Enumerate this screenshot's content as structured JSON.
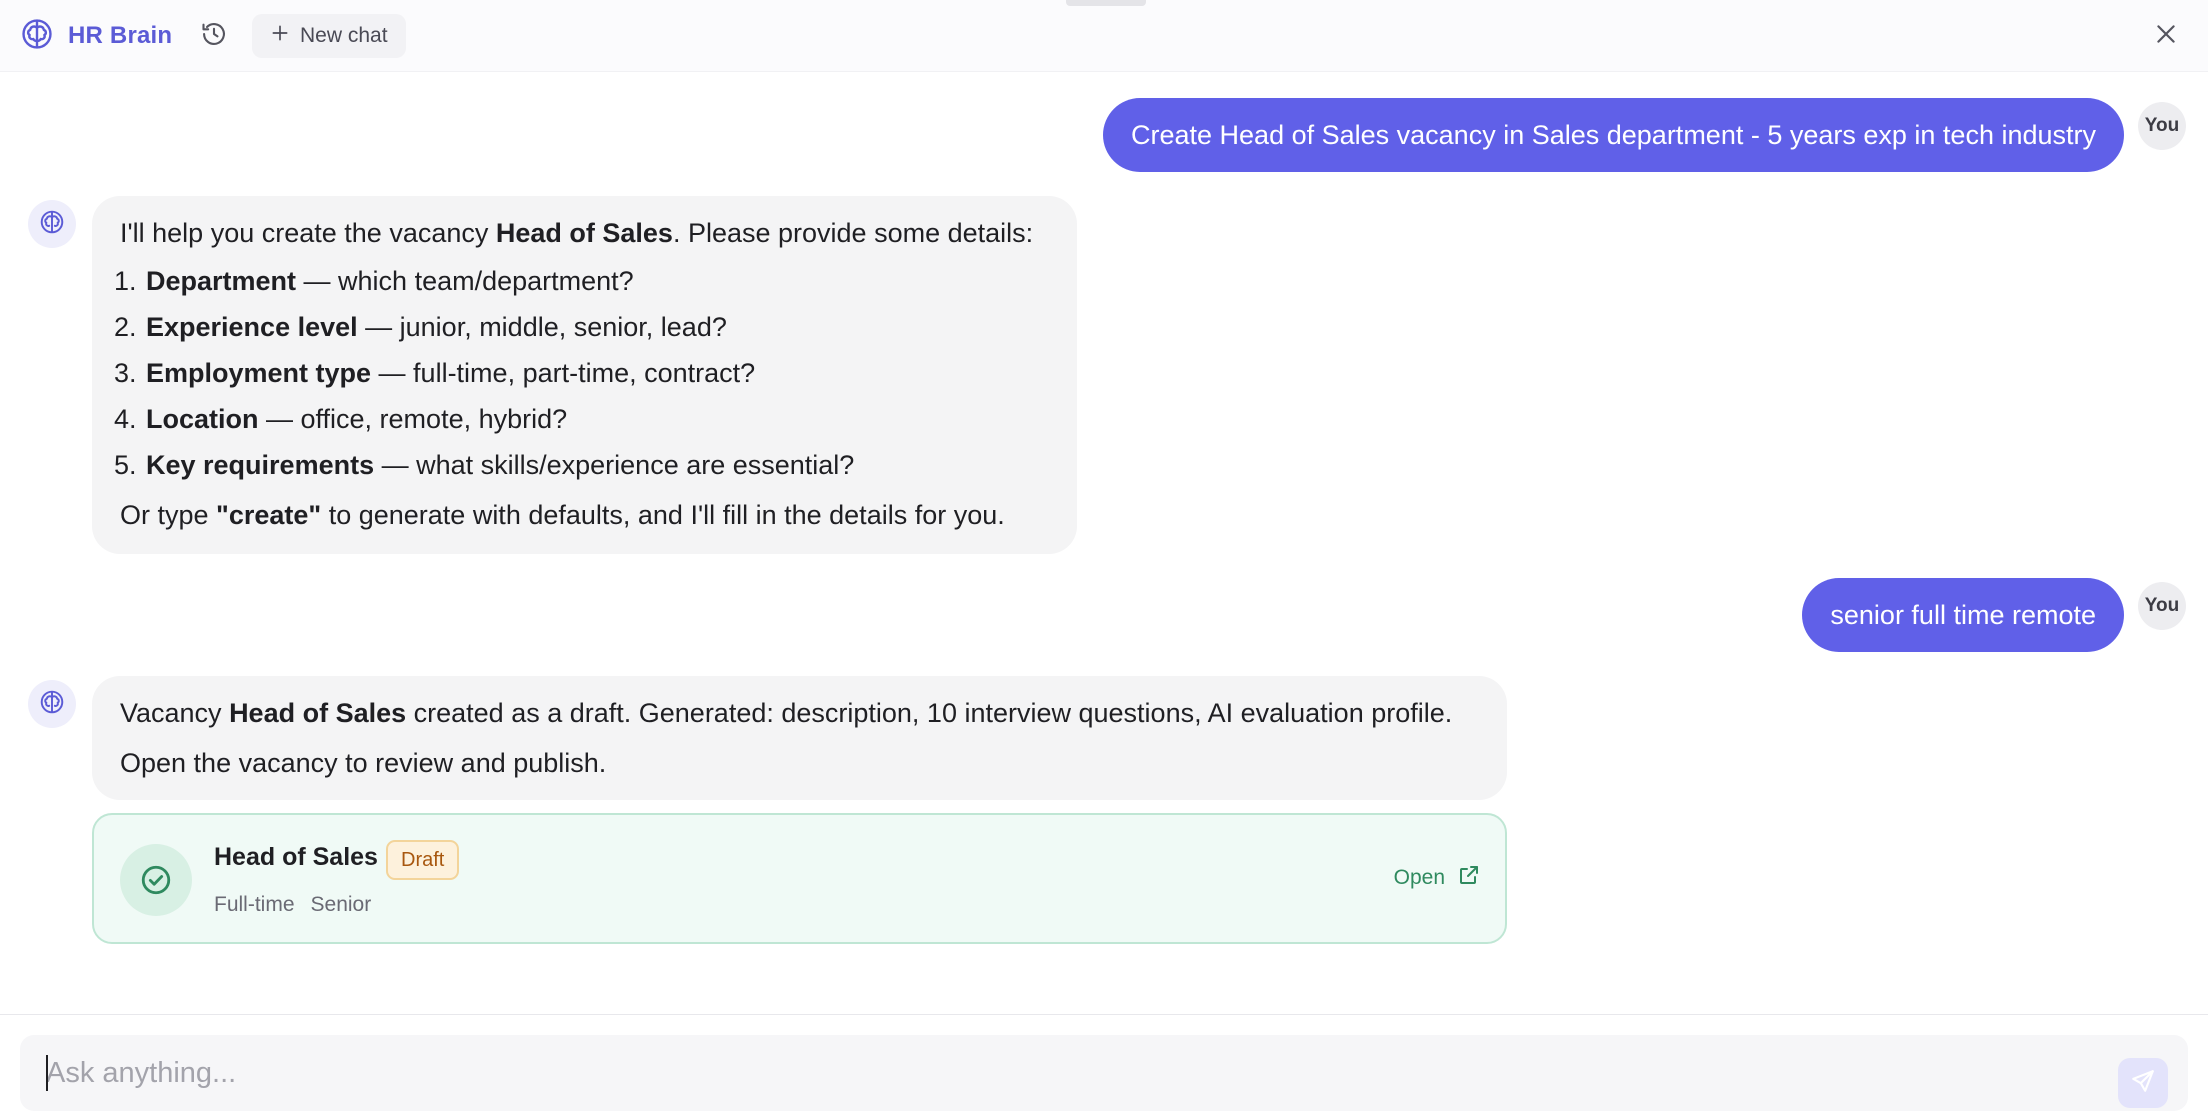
{
  "header": {
    "brand": "HR Brain",
    "brand_icon": "brain-icon",
    "history_icon": "history-icon",
    "new_chat_label": "New chat",
    "close_icon": "close-icon"
  },
  "messages": {
    "user_1": {
      "text": "Create Head of Sales vacancy in Sales department - 5 years exp in tech industry",
      "avatar": "You"
    },
    "bot_1": {
      "intro_prefix": "I'll help you create the vacancy ",
      "intro_bold": "Head of Sales",
      "intro_suffix": ". Please provide some details:",
      "items": [
        {
          "num": "1.",
          "label": "Department",
          "text": " — which team/department?"
        },
        {
          "num": "2.",
          "label": "Experience level",
          "text": " — junior, middle, senior, lead?"
        },
        {
          "num": "3.",
          "label": "Employment type",
          "text": " — full-time, part-time, contract?"
        },
        {
          "num": "4.",
          "label": "Location",
          "text": " — office, remote, hybrid?"
        },
        {
          "num": "5.",
          "label": "Key requirements",
          "text": " — what skills/experience are essential?"
        }
      ],
      "outro_prefix": "Or type ",
      "outro_bold": "\"create\"",
      "outro_suffix": " to generate with defaults, and I'll fill in the details for you."
    },
    "user_2": {
      "text": "senior full time remote",
      "avatar": "You"
    },
    "bot_2": {
      "line1_prefix": "Vacancy ",
      "line1_bold": "Head of Sales",
      "line1_suffix": " created as a draft. Generated: description, 10 interview questions, AI evaluation profile.",
      "line2": "Open the vacancy to review and publish."
    }
  },
  "vacancy_card": {
    "title": "Head of Sales",
    "badge": "Draft",
    "employment": "Full-time",
    "level": "Senior",
    "open_label": "Open",
    "colors": {
      "accent": "#2f8a5f",
      "badge_text": "#a8570e"
    }
  },
  "composer": {
    "placeholder": "Ask anything...",
    "value": ""
  },
  "colors": {
    "brand": "#5b5bd6",
    "user_bubble": "#6060e8",
    "bot_bubble": "#f4f4f5"
  }
}
